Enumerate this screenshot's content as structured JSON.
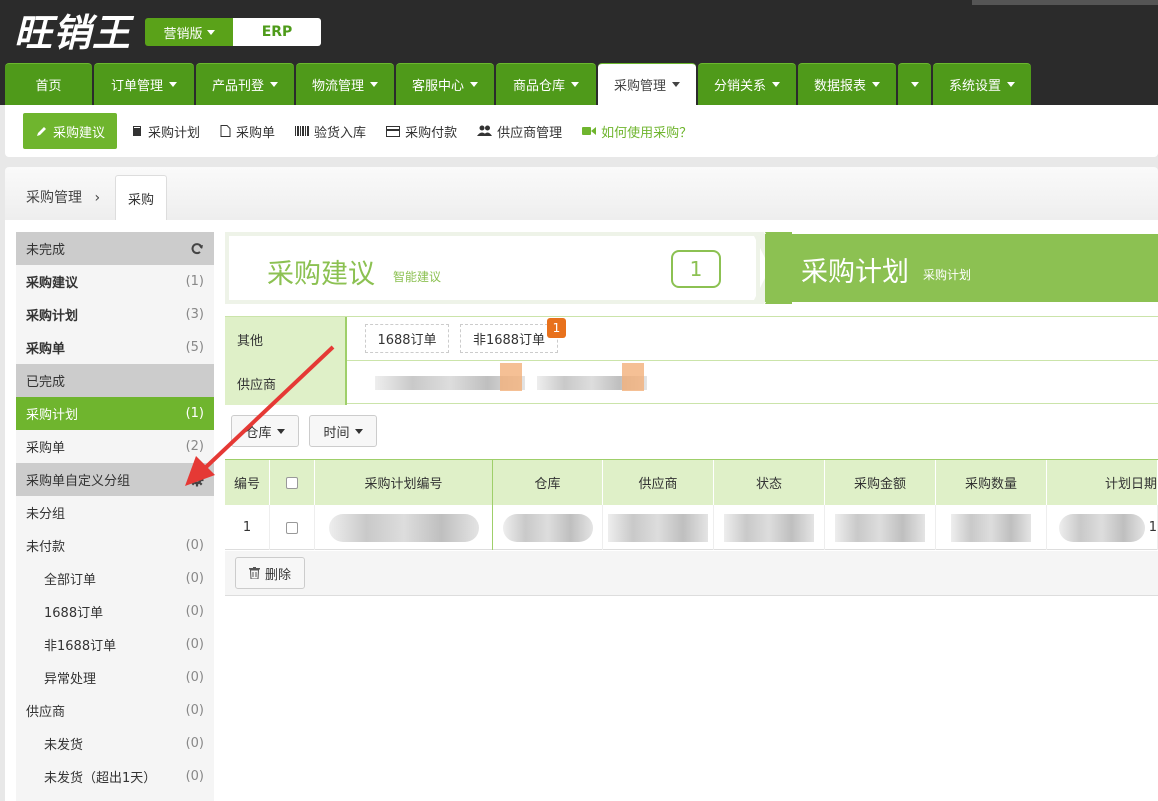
{
  "app": {
    "logo": "旺销王",
    "edition_label": "营销版",
    "edition_value": "ERP"
  },
  "nav": {
    "tabs": [
      {
        "label": "首页",
        "caret": false
      },
      {
        "label": "订单管理",
        "caret": true
      },
      {
        "label": "产品刊登",
        "caret": true
      },
      {
        "label": "物流管理",
        "caret": true
      },
      {
        "label": "客服中心",
        "caret": true
      },
      {
        "label": "商品仓库",
        "caret": true
      },
      {
        "label": "采购管理",
        "caret": true,
        "active": true
      },
      {
        "label": "分销关系",
        "caret": true
      },
      {
        "label": "数据报表",
        "caret": true
      },
      {
        "label": "",
        "caret": true
      },
      {
        "label": "系统设置",
        "caret": true
      }
    ]
  },
  "subbar": {
    "items": [
      {
        "label": "采购建议",
        "icon": "pencil-icon",
        "active": true
      },
      {
        "label": "采购计划",
        "icon": "book-icon"
      },
      {
        "label": "采购单",
        "icon": "document-icon"
      },
      {
        "label": "验货入库",
        "icon": "barcode-icon"
      },
      {
        "label": "采购付款",
        "icon": "credit-card-icon"
      },
      {
        "label": "供应商管理",
        "icon": "users-icon"
      },
      {
        "label": "如何使用采购？",
        "icon": "video-icon",
        "help": true
      }
    ]
  },
  "breadcrumb": {
    "parent": "采购管理",
    "separator": "›",
    "tab": "采购"
  },
  "sidebar": {
    "sections": [
      {
        "type": "head",
        "label": "未完成",
        "icon": "refresh-icon"
      },
      {
        "type": "row",
        "label": "采购建议",
        "count": "(1)",
        "bold": true
      },
      {
        "type": "row",
        "label": "采购计划",
        "count": "(3)",
        "bold": true
      },
      {
        "type": "row",
        "label": "采购单",
        "count": "(5)",
        "bold": true
      },
      {
        "type": "head",
        "label": "已完成"
      },
      {
        "type": "row",
        "label": "采购计划",
        "count": "(1)",
        "selected": true
      },
      {
        "type": "row",
        "label": "采购单",
        "count": "(2)"
      },
      {
        "type": "head",
        "label": "采购单自定义分组",
        "icon": "gear-icon"
      },
      {
        "type": "row",
        "label": "未分组",
        "count": ""
      },
      {
        "type": "row",
        "label": "未付款",
        "count": "(0)"
      },
      {
        "type": "row",
        "label": "全部订单",
        "count": "(0)",
        "indent": true
      },
      {
        "type": "row",
        "label": "1688订单",
        "count": "(0)",
        "indent": true
      },
      {
        "type": "row",
        "label": "非1688订单",
        "count": "(0)",
        "indent": true
      },
      {
        "type": "row",
        "label": "异常处理",
        "count": "(0)",
        "indent": true
      },
      {
        "type": "row",
        "label": "供应商",
        "count": "(0)"
      },
      {
        "type": "row",
        "label": "未发货",
        "count": "(0)",
        "indent": true
      },
      {
        "type": "row",
        "label": "未发货（超出1天）",
        "count": "(0)",
        "indent": true
      }
    ]
  },
  "steps": {
    "step1_title": "采购建议",
    "step1_sub": "智能建议",
    "step1_count": "1",
    "step2_title": "采购计划",
    "step2_sub": "采购计划"
  },
  "filters": {
    "row1_label": "其他",
    "chip1": "1688订单",
    "chip2": "非1688订单",
    "chip2_badge": "1",
    "row2_label": "供应商"
  },
  "toolbar": {
    "warehouse": "仓库",
    "time": "时间",
    "delete": "删除"
  },
  "table": {
    "headers": [
      "编号",
      "",
      "采购计划编号",
      "仓库",
      "供应商",
      "状态",
      "采购金额",
      "采购数量",
      "计划日期"
    ],
    "rows": [
      {
        "index": "1",
        "trailing": "1"
      }
    ]
  },
  "colors": {
    "brand_green": "#4f9a1a",
    "accent_green": "#6fb52e",
    "light_green": "#8cc152",
    "badge_orange": "#e8711c",
    "annotation_red": "#e53935"
  }
}
